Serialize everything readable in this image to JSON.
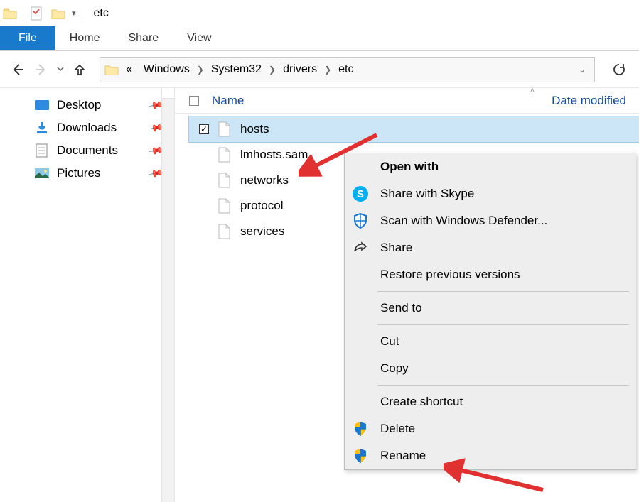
{
  "window": {
    "title": "etc"
  },
  "ribbon": {
    "file": "File",
    "tabs": [
      "Home",
      "Share",
      "View"
    ]
  },
  "breadcrumb": [
    "Windows",
    "System32",
    "drivers",
    "etc"
  ],
  "columns": {
    "name": "Name",
    "date": "Date modified"
  },
  "sidebar": {
    "items": [
      {
        "label": "Desktop"
      },
      {
        "label": "Downloads"
      },
      {
        "label": "Documents"
      },
      {
        "label": "Pictures"
      }
    ]
  },
  "files": [
    {
      "name": "hosts",
      "selected": true
    },
    {
      "name": "lmhosts.sam"
    },
    {
      "name": "networks"
    },
    {
      "name": "protocol"
    },
    {
      "name": "services"
    }
  ],
  "context_menu": {
    "open_with": "Open with",
    "share_skype": "Share with Skype",
    "scan_defender": "Scan with Windows Defender...",
    "share": "Share",
    "restore": "Restore previous versions",
    "send_to": "Send to",
    "cut": "Cut",
    "copy": "Copy",
    "shortcut": "Create shortcut",
    "delete": "Delete",
    "rename": "Rename"
  }
}
